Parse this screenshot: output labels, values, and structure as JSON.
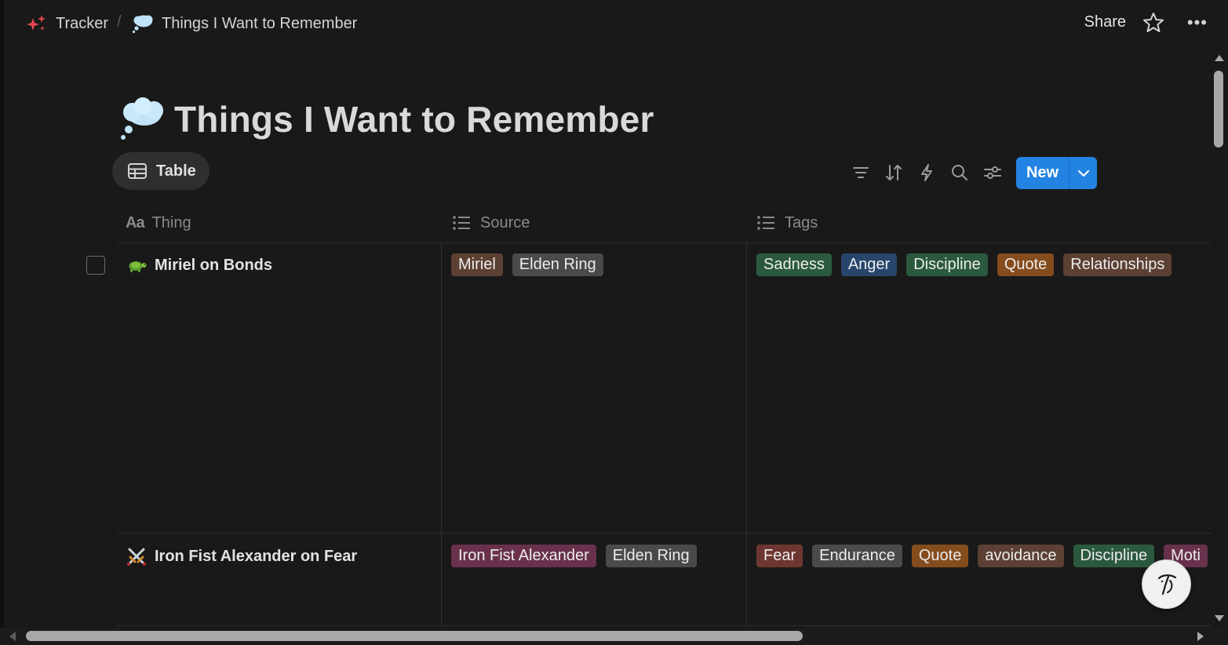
{
  "breadcrumb": {
    "workspace": "Tracker",
    "separator": "/",
    "page": "Things I Want to Remember"
  },
  "topbar": {
    "share_label": "Share"
  },
  "page": {
    "title": "Things I Want to Remember"
  },
  "view": {
    "tab_label": "Table"
  },
  "toolbar": {
    "new_label": "New"
  },
  "columns": [
    {
      "label": "Thing",
      "icon": "text-aa-icon"
    },
    {
      "label": "Source",
      "icon": "list-icon"
    },
    {
      "label": "Tags",
      "icon": "list-icon"
    }
  ],
  "rows": [
    {
      "icon": "turtle-icon",
      "name": "Miriel on Bonds",
      "source": [
        "Miriel",
        "Elden Ring"
      ],
      "tags": [
        "Sadness",
        "Anger",
        "Discipline",
        "Quote",
        "Relationships"
      ]
    },
    {
      "icon": "crossed-swords-icon",
      "name": "Iron Fist Alexander on Fear",
      "source": [
        "Iron Fist Alexander",
        "Elden Ring"
      ],
      "tags": [
        "Fear",
        "Endurance",
        "Quote",
        "avoidance",
        "Discipline",
        "Moti"
      ]
    }
  ],
  "colors": {
    "background": "#191919",
    "accent": "#2383e2",
    "tag_brown": "#5c4033",
    "tag_gray": "#4a4a4a",
    "tag_green": "#2b593f",
    "tag_blue": "#28456c",
    "tag_orange": "#854c1d",
    "tag_red": "#6e3630",
    "tag_pink": "#69314c"
  }
}
